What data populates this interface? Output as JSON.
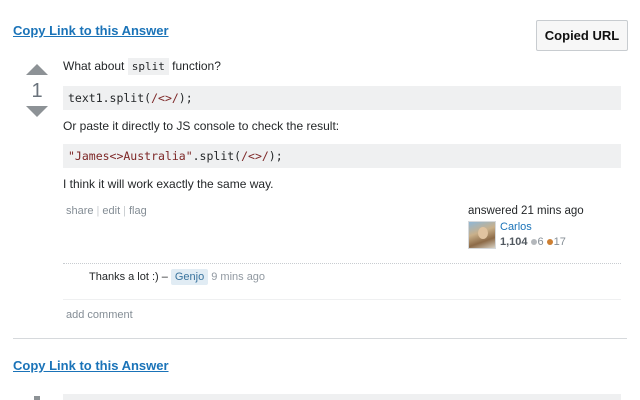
{
  "copy_link_label": "Copy Link to this Answer",
  "copied_button_label": "Copied URL",
  "answer": {
    "vote_count": "1",
    "intro_before": "What about ",
    "intro_code": "split",
    "intro_after": " function?",
    "code1_plain": "text1.split(",
    "code1_regex": "/<>/",
    "code1_end": ");",
    "paragraph2": "Or paste it directly to JS console to check the result:",
    "code2_string": "\"James<>Australia\"",
    "code2_mid": ".split(",
    "code2_regex": "/<>/",
    "code2_end": ");",
    "paragraph3": "I think it will work exactly the same way."
  },
  "post_menu": {
    "share": "share",
    "edit": "edit",
    "flag": "flag",
    "separator": "|"
  },
  "user_card": {
    "action_time": "answered 21 mins ago",
    "name": "Carlos",
    "reputation": "1,104",
    "silver_badges": "6",
    "bronze_badges": "17",
    "colors": {
      "silver": "#b4b8bc",
      "bronze": "#cd7f32"
    }
  },
  "comment": {
    "text": "Thanks a lot :) –",
    "user": "Genjo",
    "time": "9 mins ago"
  },
  "add_comment_label": "add comment",
  "colors": {
    "link": "#1a73b8",
    "code_bg": "#eff0f1",
    "vote_arrow": "#8d9296"
  }
}
